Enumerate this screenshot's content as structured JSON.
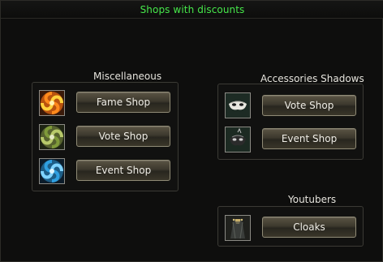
{
  "window": {
    "title": "Shops with discounts"
  },
  "groups": {
    "misc": {
      "title": "Miscellaneous",
      "items": [
        {
          "label": "Fame Shop",
          "icon": "orange-swirl-icon"
        },
        {
          "label": "Vote Shop",
          "icon": "green-swirl-icon"
        },
        {
          "label": "Event Shop",
          "icon": "blue-swirl-icon"
        }
      ]
    },
    "accessories": {
      "title": "Accessories Shadows",
      "items": [
        {
          "label": "Vote Shop",
          "icon": "white-mask-icon"
        },
        {
          "label": "Event Shop",
          "icon": "dark-mask-icon"
        }
      ]
    },
    "youtubers": {
      "title": "Youtubers",
      "items": [
        {
          "label": "Cloaks",
          "icon": "cloak-icon"
        }
      ]
    }
  },
  "colors": {
    "title": "#46e84a",
    "button_border": "#8f8a76"
  }
}
